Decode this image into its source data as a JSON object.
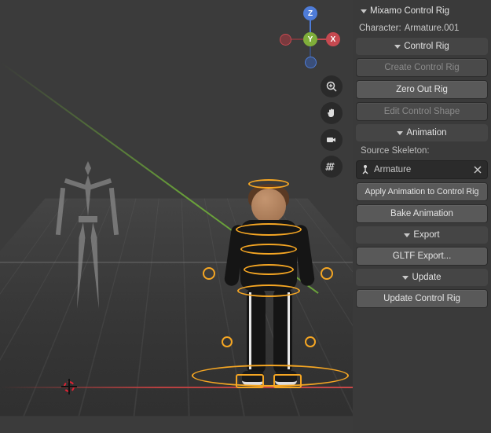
{
  "panel": {
    "title": "Mixamo Control Rig",
    "character_label": "Character:",
    "character_value": "Armature.001",
    "sections": {
      "control_rig": {
        "label": "Control Rig",
        "create_btn": "Create Control Rig",
        "zero_btn": "Zero Out Rig",
        "edit_btn": "Edit Control Shape"
      },
      "animation": {
        "label": "Animation",
        "source_label": "Source Skeleton:",
        "source_value": "Armature",
        "apply_btn": "Apply Animation to Control Rig",
        "bake_btn": "Bake Animation"
      },
      "export": {
        "label": "Export",
        "gltf_btn": "GLTF Export..."
      },
      "update": {
        "label": "Update",
        "update_btn": "Update Control Rig"
      }
    }
  },
  "gizmo": {
    "x": "X",
    "y": "Y",
    "z": "Z"
  },
  "vp_tools": {
    "zoom": "zoom-icon",
    "pan": "pan-hand-icon",
    "camera": "camera-icon",
    "grid": "grid-ortho-icon"
  },
  "colors": {
    "accent": "#f5a623",
    "axis_x": "#c64950",
    "axis_y": "#7fae3a",
    "axis_z": "#4e7cd8"
  }
}
